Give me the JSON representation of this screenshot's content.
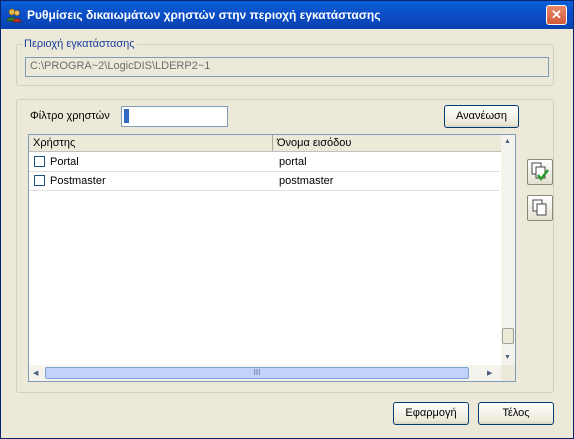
{
  "window": {
    "title": "Ρυθμίσεις δικαιωμάτων χρηστών στην περιοχή εγκατάστασης",
    "close_glyph": "✕"
  },
  "install_area": {
    "group_label": "Περιοχή εγκατάστασης",
    "path": "C:\\PROGRA~2\\LogicDIS\\LDERP2~1"
  },
  "filter": {
    "label": "Φίλτρο χρηστών",
    "value": "",
    "refresh_label": "Ανανέωση"
  },
  "table": {
    "columns": [
      "Χρήστης",
      "Όνομα εισόδου"
    ],
    "rows": [
      {
        "user": "Portal",
        "login": "portal",
        "checked": false
      },
      {
        "user": "Postmaster",
        "login": "postmaster",
        "checked": false
      }
    ],
    "hscroll_grip": "III"
  },
  "side_buttons": {
    "check_all_icon": "copy-check-icon",
    "uncheck_all_icon": "copy-icon"
  },
  "footer": {
    "apply_label": "Εφαρμογή",
    "close_label": "Τέλος"
  }
}
